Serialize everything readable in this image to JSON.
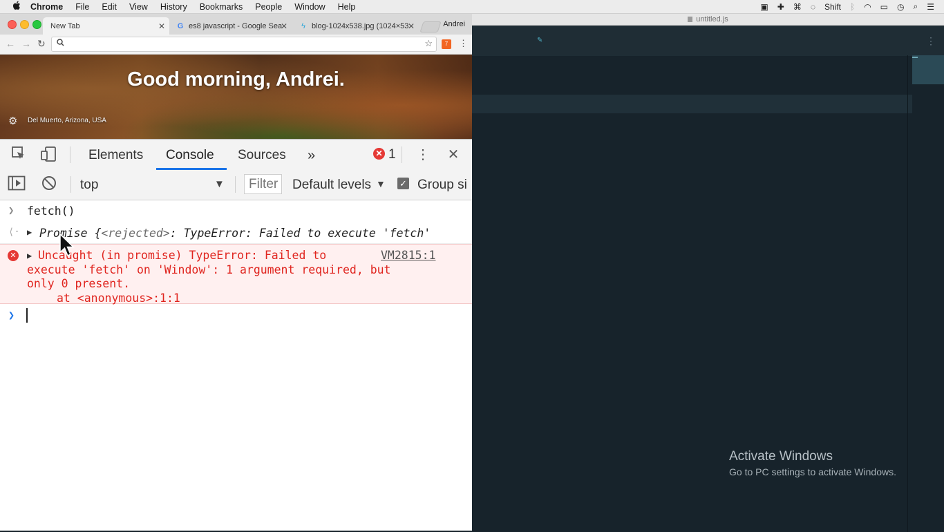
{
  "menubar": {
    "items": [
      "Chrome",
      "File",
      "Edit",
      "View",
      "History",
      "Bookmarks",
      "People",
      "Window",
      "Help"
    ],
    "shift_label": "Shift"
  },
  "editor": {
    "title": "untitled.js",
    "activate_title": "Activate Windows",
    "activate_sub": "Go to PC settings to activate Windows."
  },
  "chrome": {
    "tabs": [
      {
        "label": "New Tab"
      },
      {
        "label": "es8 javascript - Google Searc"
      },
      {
        "label": "blog-1024x538.jpg (1024×53"
      }
    ],
    "profile": "Andrei",
    "ntp": {
      "greeting": "Good morning, Andrei.",
      "location": "Del Muerto, Arizona, USA"
    }
  },
  "devtools": {
    "tabs": [
      "Elements",
      "Console",
      "Sources"
    ],
    "error_count": "1",
    "context": "top",
    "filter_placeholder": "Filter",
    "levels": "Default levels",
    "group_label": "Group si",
    "console": {
      "input": "fetch()",
      "result_prefix": "Promise {",
      "result_dim": "<rejected>",
      "result_rest": ": TypeError: Failed to execute 'fetch'",
      "error_line1": "Uncaught (in promise) TypeError: Failed to",
      "error_line2": "execute 'fetch' on 'Window': 1 argument required, but",
      "error_line3": "only 0 present.",
      "error_line4": "at <anonymous>:1:1",
      "error_source": "VM2815:1"
    }
  }
}
